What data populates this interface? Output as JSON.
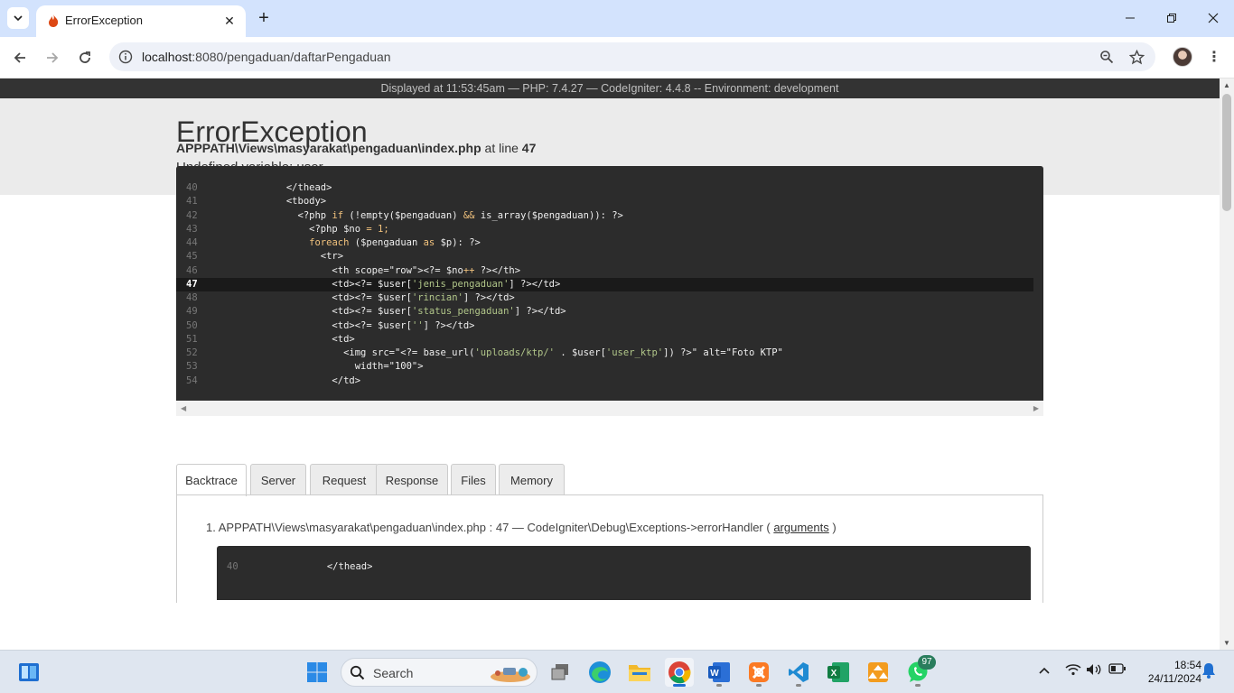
{
  "browser": {
    "tab_title": "ErrorException",
    "url_host": "localhost",
    "url_rest": ":8080/pengaduan/daftarPengaduan"
  },
  "env_bar": "Displayed at 11:53:45am — PHP: 7.4.27 — CodeIgniter: 4.4.8 -- Environment: development",
  "error": {
    "title": "ErrorException",
    "message": "Undefined variable: user",
    "file": "APPPATH\\Views\\masyarakat\\pengaduan\\index.php",
    "at_line_label": "at line",
    "line": "47"
  },
  "source_lines": [
    {
      "n": "40",
      "code": "            </thead>"
    },
    {
      "n": "41",
      "code": "            <tbody>"
    },
    {
      "n": "42",
      "code": "              <?php if (!empty($pengaduan) && is_array($pengaduan)): ?>"
    },
    {
      "n": "43",
      "code": "                <?php $no = 1;"
    },
    {
      "n": "44",
      "code": "                foreach ($pengaduan as $p): ?>"
    },
    {
      "n": "45",
      "code": "                  <tr>"
    },
    {
      "n": "46",
      "code": "                    <th scope=\"row\"><?= $no++ ?></th>"
    },
    {
      "n": "47",
      "code": "                    <td><?= $user['jenis_pengaduan'] ?></td>"
    },
    {
      "n": "48",
      "code": "                    <td><?= $user['rincian'] ?></td>"
    },
    {
      "n": "49",
      "code": "                    <td><?= $user['status_pengaduan'] ?></td>"
    },
    {
      "n": "50",
      "code": "                    <td><?= $user[''] ?></td>"
    },
    {
      "n": "51",
      "code": "                    <td>"
    },
    {
      "n": "52",
      "code": "                      <img src=\"<?= base_url('uploads/ktp/' . $user['user_ktp']) ?>\" alt=\"Foto KTP\""
    },
    {
      "n": "53",
      "code": "                        width=\"100\">"
    },
    {
      "n": "54",
      "code": "                    </td>"
    }
  ],
  "highlight_line": "47",
  "tabs": [
    "Backtrace",
    "Server",
    "Request",
    "Response",
    "Files",
    "Memory"
  ],
  "backtrace": {
    "item": "1. APPPATH\\Views\\masyarakat\\pengaduan\\index.php : 47   —  CodeIgniter\\Debug\\Exceptions->errorHandler ( ",
    "link": "arguments",
    "close": " )",
    "first_line_n": "40",
    "first_line_code": "            </thead>"
  },
  "taskbar": {
    "search_placeholder": "Search",
    "whatsapp_badge": "97",
    "time": "18:54",
    "date": "24/11/2024"
  }
}
